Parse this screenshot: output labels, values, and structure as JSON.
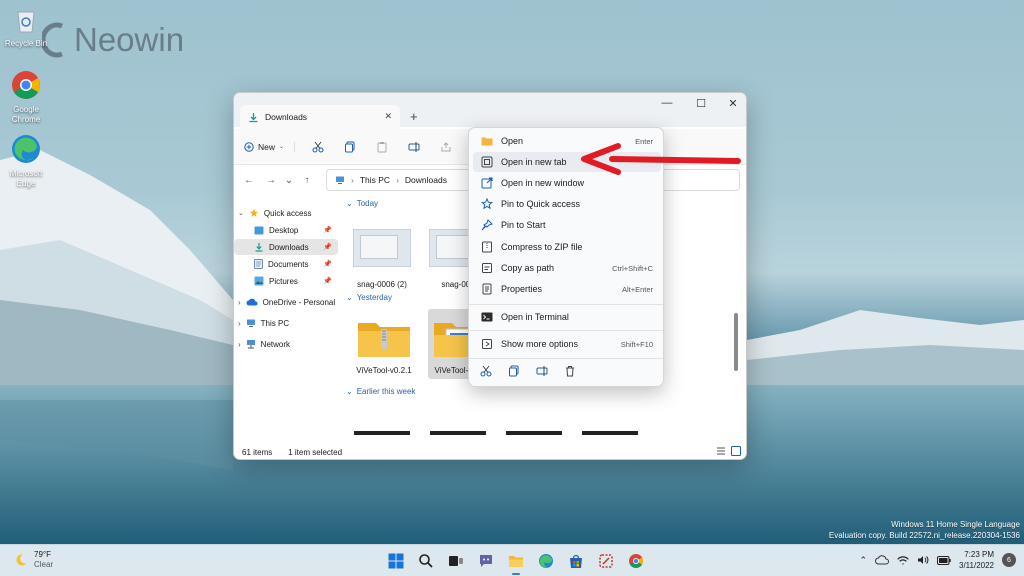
{
  "watermark": {
    "brand": "Neowin"
  },
  "desktop_icons": [
    {
      "label": "Recycle Bin",
      "icon": "recycle-bin-icon"
    },
    {
      "label": "Google Chrome",
      "icon": "chrome-icon"
    },
    {
      "label": "Microsoft Edge",
      "icon": "edge-icon"
    }
  ],
  "evaluation": {
    "line1": "Windows 11 Home Single Language",
    "line2": "Evaluation copy. Build 22572.ni_release.220304-1536"
  },
  "explorer": {
    "tab_title": "Downloads",
    "toolbar": {
      "new_label": "New"
    },
    "address": {
      "crumb1": "This PC",
      "crumb2": "Downloads"
    },
    "nav": {
      "quick_access": "Quick access",
      "desktop": "Desktop",
      "downloads": "Downloads",
      "documents": "Documents",
      "pictures": "Pictures",
      "onedrive": "OneDrive - Personal",
      "this_pc": "This PC",
      "network": "Network"
    },
    "groups": {
      "today": "Today",
      "yesterday": "Yesterday",
      "earlier": "Earlier this week"
    },
    "files": {
      "snag1": "snag-0006 (2)",
      "snag2": "snag-000",
      "vive1": "ViVeTool-v0.2.1",
      "vive2": "ViVeTool-v0.2."
    },
    "status": {
      "count": "61 items",
      "selected": "1 item selected"
    }
  },
  "context_menu": {
    "items": [
      {
        "label": "Open",
        "shortcut": "Enter",
        "icon": "folder-icon"
      },
      {
        "label": "Open in new tab",
        "shortcut": "",
        "icon": "new-tab-icon"
      },
      {
        "label": "Open in new window",
        "shortcut": "",
        "icon": "new-window-icon"
      },
      {
        "label": "Pin to Quick access",
        "shortcut": "",
        "icon": "star-icon"
      },
      {
        "label": "Pin to Start",
        "shortcut": "",
        "icon": "pin-icon"
      },
      {
        "label": "Compress to ZIP file",
        "shortcut": "",
        "icon": "zip-icon"
      },
      {
        "label": "Copy as path",
        "shortcut": "Ctrl+Shift+C",
        "icon": "copy-path-icon"
      },
      {
        "label": "Properties",
        "shortcut": "Alt+Enter",
        "icon": "properties-icon"
      },
      {
        "label": "Open in Terminal",
        "shortcut": "",
        "icon": "terminal-icon"
      },
      {
        "label": "Show more options",
        "shortcut": "Shift+F10",
        "icon": "more-options-icon"
      }
    ]
  },
  "taskbar": {
    "weather": {
      "temp": "79°F",
      "condition": "Clear"
    },
    "clock": {
      "time": "7:23 PM",
      "date": "3/11/2022"
    },
    "notifications": "6"
  }
}
